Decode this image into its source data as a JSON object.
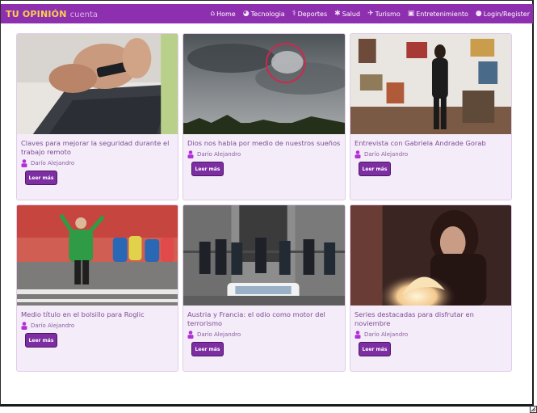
{
  "brand": {
    "main": "TU OPINIÓN",
    "sub": "cuenta"
  },
  "nav": [
    {
      "label": "Home",
      "icon": "home-icon"
    },
    {
      "label": "Tecnologia",
      "icon": "tech-icon"
    },
    {
      "label": "Deportes",
      "icon": "sports-icon"
    },
    {
      "label": "Salud",
      "icon": "health-icon"
    },
    {
      "label": "Turismo",
      "icon": "plane-icon"
    },
    {
      "label": "Entretenimiento",
      "icon": "entertainment-icon"
    },
    {
      "label": "Login/Register",
      "icon": "user-icon"
    }
  ],
  "colors": {
    "navbar": "#8e2fb0",
    "brand": "#f7d24a",
    "button": "#7d2ea2",
    "card": "#f4ecf8",
    "text": "#7e4b96"
  },
  "cards": [
    {
      "title": "Claves para mejorar la seguridad durante el trabajo remoto",
      "author": "Darío Alejandro",
      "button": "Leer más",
      "image": "laptop-phone-photo"
    },
    {
      "title": "Dios nos habla por medio de nuestros sueños",
      "author": "Darío Alejandro",
      "button": "Leer más",
      "image": "cloudy-sky-photo"
    },
    {
      "title": "Entrevista con Gabriela Andrade Gorab",
      "author": "Darío Alejandro",
      "button": "Leer más",
      "image": "woman-room-photo"
    },
    {
      "title": "Medio título en el bolsillo para Roglic",
      "author": "Darío Alejandro",
      "button": "Leer más",
      "image": "cyclists-photo"
    },
    {
      "title": "Austria y Francia: el odio como motor del terrorismo",
      "author": "Darío Alejandro",
      "button": "Leer más",
      "image": "police-street-photo"
    },
    {
      "title": "Series destacadas para disfrutar en noviembre",
      "author": "Darío Alejandro",
      "button": "Leer más",
      "image": "woman-book-photo"
    }
  ]
}
